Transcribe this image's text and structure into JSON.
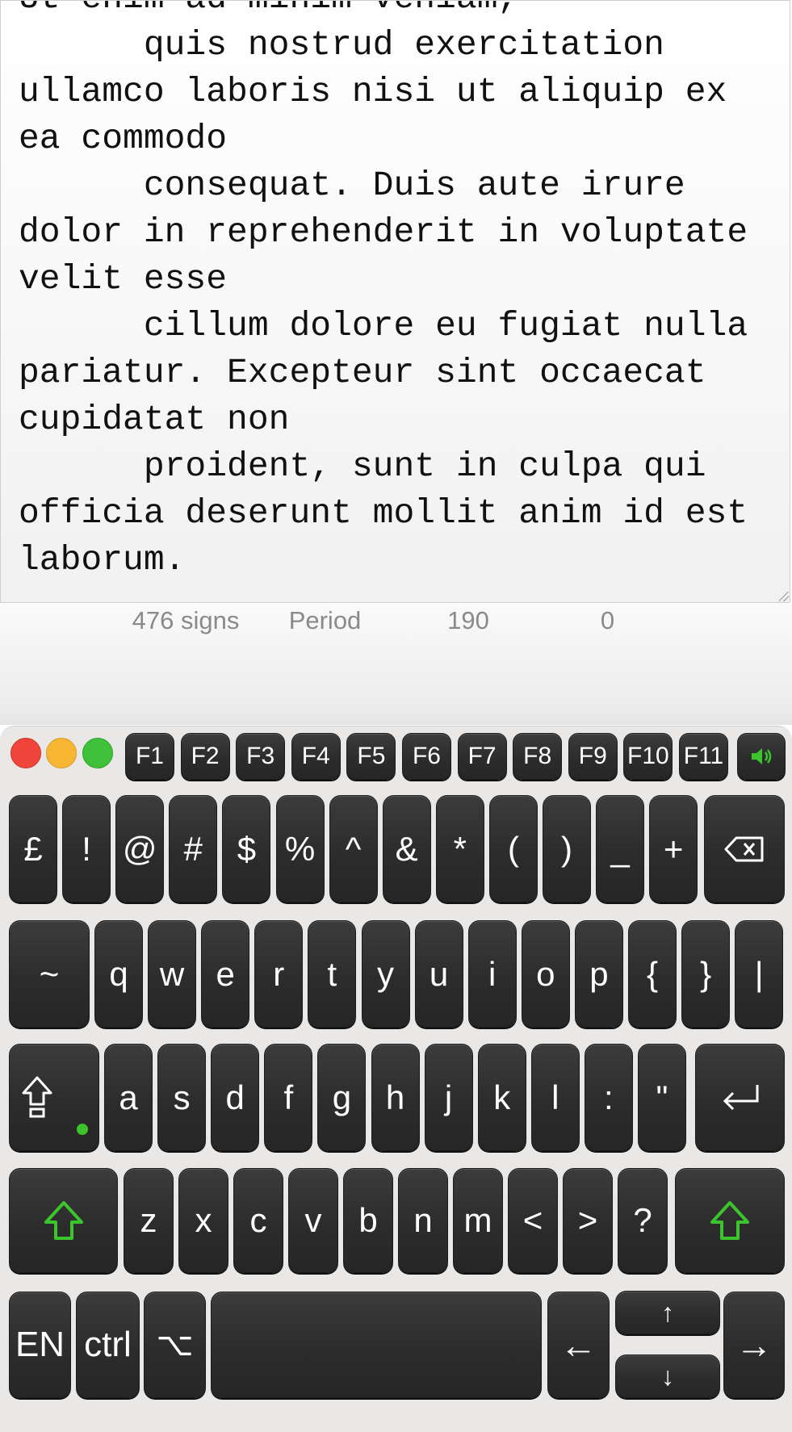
{
  "editor": {
    "text": "Ut enim ad minim veniam,\n      quis nostrud exercitation ullamco laboris nisi ut aliquip ex ea commodo\n      consequat. Duis aute irure dolor in reprehenderit in voluptate velit esse\n      cillum dolore eu fugiat nulla pariatur. Excepteur sint occaecat cupidatat non\n      proident, sunt in culpa qui officia deserunt mollit anim id est laborum."
  },
  "status": {
    "signs": "476 signs",
    "mode": "Period",
    "count": "190",
    "value": "0"
  },
  "colors": {
    "close": "#f0453a",
    "minimize": "#f7b733",
    "zoom": "#3fc23a",
    "accent_green": "#3cc42c",
    "key_dark": "#2c2c2c"
  },
  "keyboard": {
    "function_keys": [
      "F1",
      "F2",
      "F3",
      "F4",
      "F5",
      "F6",
      "F7",
      "F8",
      "F9",
      "F10",
      "F11"
    ],
    "sound_icon": "speaker-icon",
    "row1": [
      "£",
      "!",
      "@",
      "#",
      "$",
      "%",
      "^",
      "&",
      "*",
      "(",
      ")",
      "_",
      "+"
    ],
    "row2": [
      "~",
      "q",
      "w",
      "e",
      "r",
      "t",
      "y",
      "u",
      "i",
      "o",
      "p",
      "{",
      "}",
      "|"
    ],
    "row3": [
      "a",
      "s",
      "d",
      "f",
      "g",
      "h",
      "j",
      "k",
      "l",
      ":",
      "\""
    ],
    "row4": [
      "z",
      "x",
      "c",
      "v",
      "b",
      "n",
      "m",
      "<",
      ">",
      "?"
    ],
    "language": "EN",
    "ctrl": "ctrl",
    "option": "⌥",
    "left": "←",
    "right": "→",
    "up": "↑",
    "down": "↓",
    "backspace_icon": "backspace-icon",
    "enter_icon": "return-icon",
    "capslock_icon": "caps-lock-icon",
    "shift_icon": "shift-icon"
  }
}
